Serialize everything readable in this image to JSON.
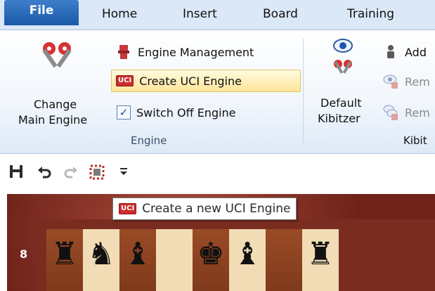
{
  "menu": {
    "tabs": [
      "File",
      "Home",
      "Insert",
      "Board",
      "Training"
    ]
  },
  "ribbon": {
    "engine_group": {
      "change_main_engine": [
        "Change",
        "Main Engine"
      ],
      "engine_management": "Engine Management",
      "create_uci_engine": "Create UCI Engine",
      "switch_off_engine": "Switch Off Engine",
      "switch_off_checked": true,
      "label": "Engine"
    },
    "kibitzer_group": {
      "default_kibitzer": [
        "Default",
        "Kibitzer"
      ],
      "add": "Add",
      "remove1": "Rem",
      "remove2": "Rem",
      "label": "Kibit"
    }
  },
  "quick_access": {
    "icons": [
      "save-icon",
      "undo-icon",
      "redo-icon",
      "engine-icon",
      "customize-dropdown-icon"
    ]
  },
  "board": {
    "rank_label": "8",
    "pieces_rank8": [
      "♜",
      "♞",
      "♝",
      "",
      "♚",
      "♝",
      "",
      "♜"
    ]
  },
  "tooltip": {
    "badge": "UCI",
    "text": "Create a new UCI Engine"
  },
  "colors": {
    "accent": "#1b5aa8",
    "highlight": "#ffe59a",
    "board_frame": "#6e2219"
  }
}
